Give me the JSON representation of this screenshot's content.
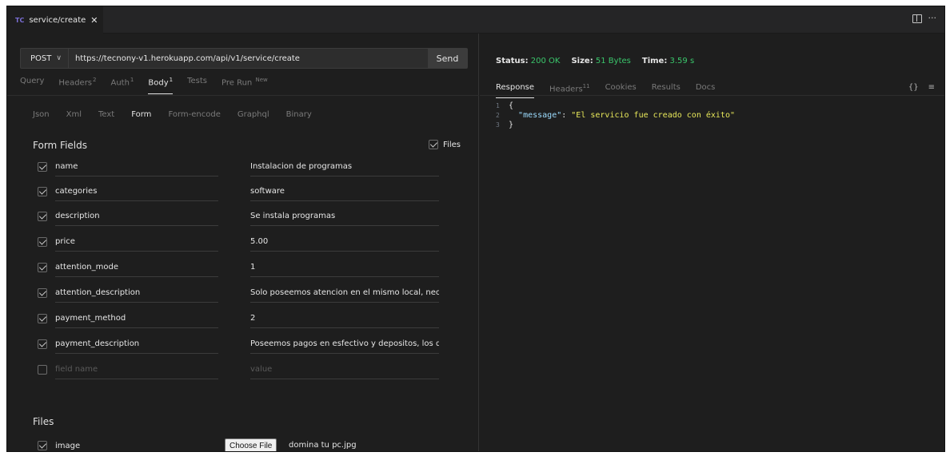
{
  "tab": {
    "logo": "TC",
    "title": "service/create",
    "close": "✕"
  },
  "window_actions": {
    "more": "···"
  },
  "request": {
    "method": "POST",
    "url": "https://tecnony-v1.herokuapp.com/api/v1/service/create",
    "send_label": "Send",
    "tabs": [
      {
        "label": "Query",
        "badge": ""
      },
      {
        "label": "Headers",
        "badge": "2"
      },
      {
        "label": "Auth",
        "badge": "1"
      },
      {
        "label": "Body",
        "badge": "1"
      },
      {
        "label": "Tests",
        "badge": ""
      },
      {
        "label": "Pre Run",
        "badge": "New"
      }
    ],
    "active_tab": "Body",
    "body_types": [
      "Json",
      "Xml",
      "Text",
      "Form",
      "Form-encode",
      "Graphql",
      "Binary"
    ],
    "active_body_type": "Form"
  },
  "form": {
    "title": "Form Fields",
    "files_toggle_label": "Files",
    "fields": [
      {
        "name": "name",
        "value": "Instalacion de programas",
        "checked": true
      },
      {
        "name": "categories",
        "value": "software",
        "checked": true
      },
      {
        "name": "description",
        "value": "Se instala programas",
        "checked": true
      },
      {
        "name": "price",
        "value": "5.00",
        "checked": true
      },
      {
        "name": "attention_mode",
        "value": "1",
        "checked": true
      },
      {
        "name": "attention_description",
        "value": "Solo poseemos atencion en el mismo local, necesita",
        "checked": true
      },
      {
        "name": "payment_method",
        "value": "2",
        "checked": true
      },
      {
        "name": "payment_description",
        "value": "Poseemos pagos en esfectivo y depositos, los datos",
        "checked": true
      }
    ],
    "new_field": {
      "name_placeholder": "field name",
      "value_placeholder": "value"
    }
  },
  "files": {
    "title": "Files",
    "items": [
      {
        "name": "image",
        "button_label": "Choose File",
        "filename": "domina tu pc.jpg",
        "checked": true
      }
    ]
  },
  "response": {
    "status_label": "Status:",
    "status_value": "200 OK",
    "size_label": "Size:",
    "size_value": "51 Bytes",
    "time_label": "Time:",
    "time_value": "3.59 s",
    "tabs": [
      {
        "label": "Response",
        "badge": ""
      },
      {
        "label": "Headers",
        "badge": "11"
      },
      {
        "label": "Cookies",
        "badge": ""
      },
      {
        "label": "Results",
        "badge": ""
      },
      {
        "label": "Docs",
        "badge": ""
      }
    ],
    "active_tab": "Response",
    "icons": {
      "braces": "{}",
      "menu": "≡"
    },
    "body_lines": [
      {
        "num": "1",
        "open": "{"
      },
      {
        "num": "2",
        "key": "\"message\"",
        "sep": ": ",
        "value": "\"El servicio fue creado con éxito\""
      },
      {
        "num": "3",
        "close": "}"
      }
    ]
  },
  "colors": {
    "background": "#1e1e1e",
    "success": "#3ac66b",
    "accent": "#7b6fd6"
  }
}
